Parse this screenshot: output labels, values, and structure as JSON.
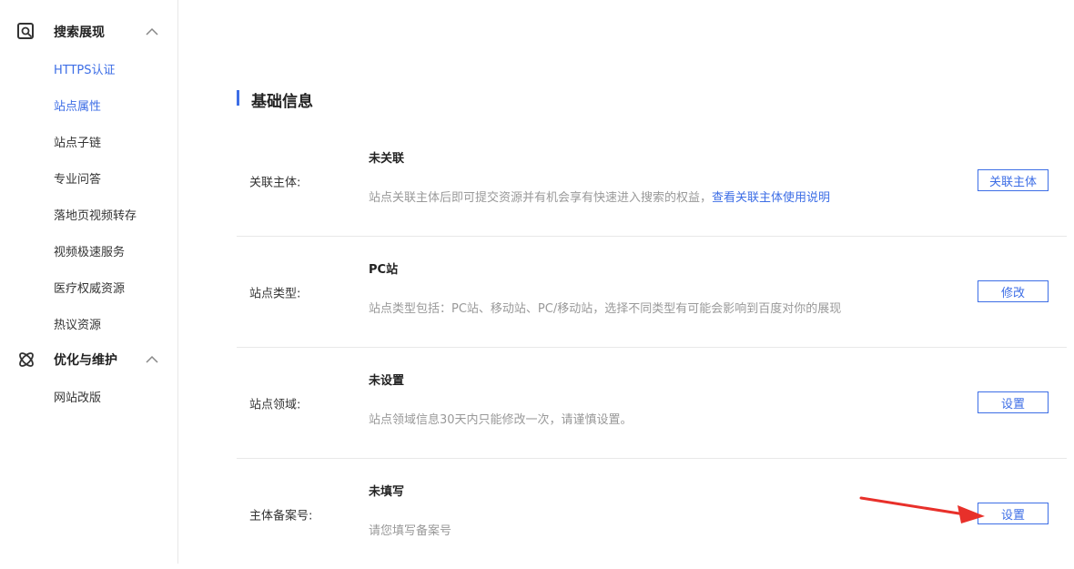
{
  "sidebar": {
    "groups": [
      {
        "title": "搜索展现",
        "icon": "search-display-icon",
        "items": [
          {
            "label": "HTTPS认证"
          },
          {
            "label": "站点属性"
          },
          {
            "label": "站点子链"
          },
          {
            "label": "专业问答"
          },
          {
            "label": "落地页视频转存"
          },
          {
            "label": "视频极速服务"
          },
          {
            "label": "医疗权威资源"
          },
          {
            "label": "热议资源"
          }
        ]
      },
      {
        "title": "优化与维护",
        "icon": "atom-icon",
        "items": [
          {
            "label": "网站改版"
          }
        ]
      }
    ]
  },
  "main": {
    "section_title": "基础信息",
    "rows": [
      {
        "label": "关联主体:",
        "value": "未关联",
        "desc": "站点关联主体后即可提交资源并有机会享有快速进入搜索的权益，",
        "link": "查看关联主体使用说明",
        "button": "关联主体"
      },
      {
        "label": "站点类型:",
        "value": "PC站",
        "desc": "站点类型包括：PC站、移动站、PC/移动站，选择不同类型有可能会影响到百度对你的展现",
        "button": "修改"
      },
      {
        "label": "站点领域:",
        "value": "未设置",
        "desc": "站点领域信息30天内只能修改一次，请谨慎设置。",
        "button": "设置"
      },
      {
        "label": "主体备案号:",
        "value": "未填写",
        "desc": "请您填写备案号",
        "button": "设置"
      }
    ]
  },
  "colors": {
    "accent": "#3d6ee6",
    "annotation_arrow": "#e8302a"
  }
}
